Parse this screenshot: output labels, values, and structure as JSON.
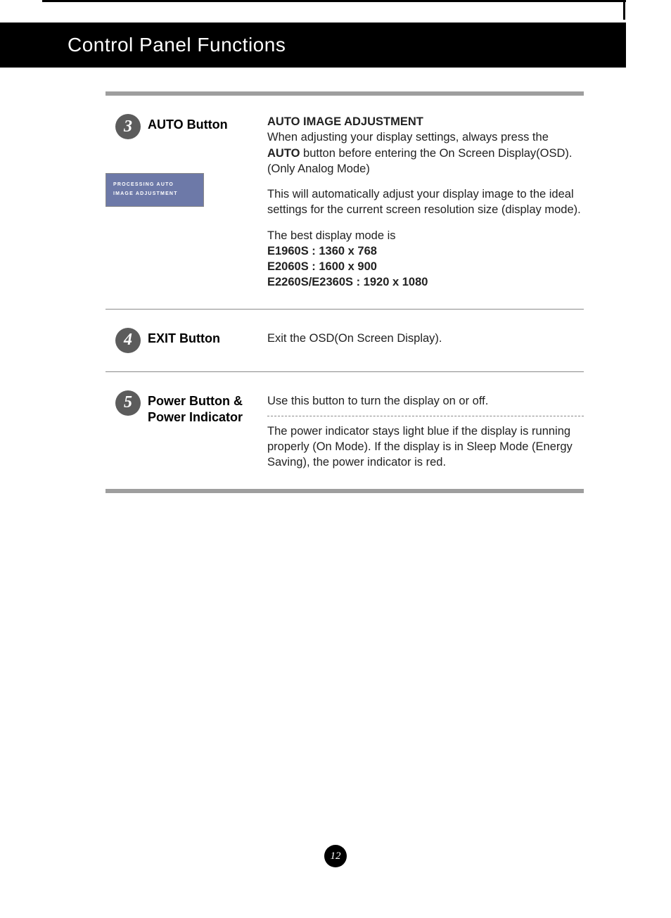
{
  "header": {
    "title": "Control Panel Functions"
  },
  "sections": [
    {
      "num": "3",
      "label": "AUTO Button",
      "osd_box_line1": "PROCESSING AUTO",
      "osd_box_line2": "IMAGE ADJUSTMENT",
      "heading": "AUTO IMAGE ADJUSTMENT",
      "p1_a": "When adjusting your display settings, always press the ",
      "p1_bold": "AUTO",
      "p1_b": " button before entering the On Screen Display(OSD). (Only Analog Mode)",
      "p2": "This will automatically adjust your display image to the ideal settings for the current screen resolution size (display mode).",
      "p3_intro": "The best display mode is",
      "modes": [
        "E1960S : 1360 x 768",
        "E2060S : 1600 x 900",
        "E2260S/E2360S : 1920 x 1080"
      ]
    },
    {
      "num": "4",
      "label": "EXIT Button",
      "p1": "Exit the OSD(On Screen Display)."
    },
    {
      "num": "5",
      "label": "Power Button & Power Indicator",
      "p1": "Use this button to turn the display on or off.",
      "p2": "The power indicator stays light blue if the display is running properly (On Mode). If the display is in Sleep Mode (Energy Saving), the power indicator is red."
    }
  ],
  "page_number": "12"
}
